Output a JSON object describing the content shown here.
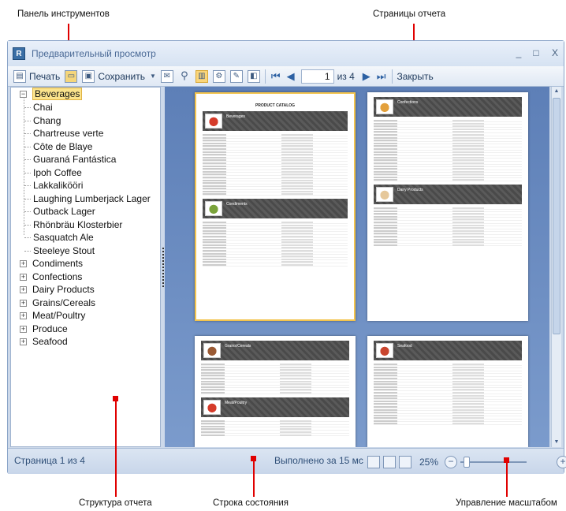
{
  "annotations": {
    "toolbar": "Панель инструментов",
    "pages": "Страницы отчета",
    "structure": "Структура отчета",
    "statusbar": "Строка состояния",
    "zoom": "Управление масштабом"
  },
  "window": {
    "title": "Предварительный просмотр",
    "icon_letter": "R",
    "controls": [
      "_",
      "□",
      "X"
    ]
  },
  "toolbar": {
    "print_label": "Печать",
    "save_label": "Сохранить",
    "page_value": "1",
    "page_of": "из 4",
    "close_label": "Закрыть",
    "icons": [
      "printer-icon",
      "open-folder-icon",
      "save-disk-icon",
      "dropdown-arrow-icon",
      "email-icon",
      "find-binoculars-icon",
      "toggle-tree-icon",
      "page-setup-icon",
      "edit-icon",
      "watermark-icon",
      "first-page-icon",
      "prev-page-icon",
      "next-page-icon",
      "last-page-icon"
    ]
  },
  "tree": {
    "root": "Beverages",
    "children": [
      "Chai",
      "Chang",
      "Chartreuse verte",
      "Côte de Blaye",
      "Guaraná Fantástica",
      "Ipoh Coffee",
      "Lakkalikööri",
      "Laughing Lumberjack Lager",
      "Outback Lager",
      "Rhönbräu Klosterbier",
      "Sasquatch Ale",
      "Steeleye Stout"
    ],
    "groups": [
      "Condiments",
      "Confections",
      "Dairy Products",
      "Grains/Cereals",
      "Meat/Poultry",
      "Produce",
      "Seafood"
    ]
  },
  "pages": {
    "page1": {
      "title": "PRODUCT CATALOG",
      "sections": [
        "Beverages",
        "Condiments"
      ]
    },
    "page2": {
      "sections": [
        "Confections",
        "Dairy Products"
      ]
    },
    "page3": {
      "sections": [
        "Grains/Cereals",
        "Meat/Poultry"
      ]
    },
    "page4": {
      "sections": [
        "Seafood"
      ]
    }
  },
  "status": {
    "page_info": "Страница 1 из 4",
    "elapsed": "Выполнено за 15 мс",
    "zoom": "25%",
    "zoom_level": 0.05
  },
  "colors": {
    "annotation_red": "#e00000",
    "selected_node": "#fbe38c",
    "page_area": "#6d8fc2"
  }
}
